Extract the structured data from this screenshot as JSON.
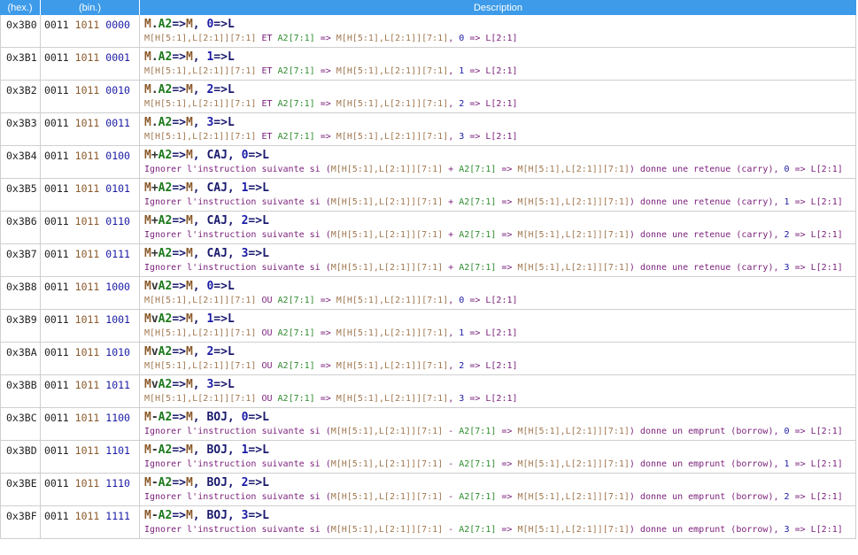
{
  "header": {
    "hex": "(hex.)",
    "bin": "(bin.)",
    "desc": "Description"
  },
  "rows": [
    {
      "hex": "0x3B0",
      "b1": "0011",
      "b2": "1011",
      "b3": "0000",
      "l1": [
        "M",
        ".",
        "A2",
        "=>",
        "M",
        ", ",
        "0",
        "=>",
        "L"
      ],
      "l2": "M[H[5:1],L[2:1]][7:1] ET A2[7:1] => M[H[5:1],L[2:1]][7:1], 0 => L[2:1]"
    },
    {
      "hex": "0x3B1",
      "b1": "0011",
      "b2": "1011",
      "b3": "0001",
      "l1": [
        "M",
        ".",
        "A2",
        "=>",
        "M",
        ", ",
        "1",
        "=>",
        "L"
      ],
      "l2": "M[H[5:1],L[2:1]][7:1] ET A2[7:1] => M[H[5:1],L[2:1]][7:1], 1 => L[2:1]"
    },
    {
      "hex": "0x3B2",
      "b1": "0011",
      "b2": "1011",
      "b3": "0010",
      "l1": [
        "M",
        ".",
        "A2",
        "=>",
        "M",
        ", ",
        "2",
        "=>",
        "L"
      ],
      "l2": "M[H[5:1],L[2:1]][7:1] ET A2[7:1] => M[H[5:1],L[2:1]][7:1], 2 => L[2:1]"
    },
    {
      "hex": "0x3B3",
      "b1": "0011",
      "b2": "1011",
      "b3": "0011",
      "l1": [
        "M",
        ".",
        "A2",
        "=>",
        "M",
        ", ",
        "3",
        "=>",
        "L"
      ],
      "l2": "M[H[5:1],L[2:1]][7:1] ET A2[7:1] => M[H[5:1],L[2:1]][7:1], 3 => L[2:1]"
    },
    {
      "hex": "0x3B4",
      "b1": "0011",
      "b2": "1011",
      "b3": "0100",
      "l1": [
        "M",
        "+",
        "A2",
        "=>",
        "M",
        ", CAJ, ",
        "0",
        "=>",
        "L"
      ],
      "l2": "Ignorer l'instruction suivante si (M[H[5:1],L[2:1]][7:1] + A2[7:1] => M[H[5:1],L[2:1]][7:1]) donne une retenue (carry), 0 => L[2:1]"
    },
    {
      "hex": "0x3B5",
      "b1": "0011",
      "b2": "1011",
      "b3": "0101",
      "l1": [
        "M",
        "+",
        "A2",
        "=>",
        "M",
        ", CAJ, ",
        "1",
        "=>",
        "L"
      ],
      "l2": "Ignorer l'instruction suivante si (M[H[5:1],L[2:1]][7:1] + A2[7:1] => M[H[5:1],L[2:1]][7:1]) donne une retenue (carry), 1 => L[2:1]"
    },
    {
      "hex": "0x3B6",
      "b1": "0011",
      "b2": "1011",
      "b3": "0110",
      "l1": [
        "M",
        "+",
        "A2",
        "=>",
        "M",
        ", CAJ, ",
        "2",
        "=>",
        "L"
      ],
      "l2": "Ignorer l'instruction suivante si (M[H[5:1],L[2:1]][7:1] + A2[7:1] => M[H[5:1],L[2:1]][7:1]) donne une retenue (carry), 2 => L[2:1]"
    },
    {
      "hex": "0x3B7",
      "b1": "0011",
      "b2": "1011",
      "b3": "0111",
      "l1": [
        "M",
        "+",
        "A2",
        "=>",
        "M",
        ", CAJ, ",
        "3",
        "=>",
        "L"
      ],
      "l2": "Ignorer l'instruction suivante si (M[H[5:1],L[2:1]][7:1] + A2[7:1] => M[H[5:1],L[2:1]][7:1]) donne une retenue (carry), 3 => L[2:1]"
    },
    {
      "hex": "0x3B8",
      "b1": "0011",
      "b2": "1011",
      "b3": "1000",
      "l1": [
        "M",
        "v",
        "A2",
        "=>",
        "M",
        ", ",
        "0",
        "=>",
        "L"
      ],
      "l2": "M[H[5:1],L[2:1]][7:1] OU A2[7:1] => M[H[5:1],L[2:1]][7:1], 0 => L[2:1]"
    },
    {
      "hex": "0x3B9",
      "b1": "0011",
      "b2": "1011",
      "b3": "1001",
      "l1": [
        "M",
        "v",
        "A2",
        "=>",
        "M",
        ", ",
        "1",
        "=>",
        "L"
      ],
      "l2": "M[H[5:1],L[2:1]][7:1] OU A2[7:1] => M[H[5:1],L[2:1]][7:1], 1 => L[2:1]"
    },
    {
      "hex": "0x3BA",
      "b1": "0011",
      "b2": "1011",
      "b3": "1010",
      "l1": [
        "M",
        "v",
        "A2",
        "=>",
        "M",
        ", ",
        "2",
        "=>",
        "L"
      ],
      "l2": "M[H[5:1],L[2:1]][7:1] OU A2[7:1] => M[H[5:1],L[2:1]][7:1], 2 => L[2:1]"
    },
    {
      "hex": "0x3BB",
      "b1": "0011",
      "b2": "1011",
      "b3": "1011",
      "l1": [
        "M",
        "v",
        "A2",
        "=>",
        "M",
        ", ",
        "3",
        "=>",
        "L"
      ],
      "l2": "M[H[5:1],L[2:1]][7:1] OU A2[7:1] => M[H[5:1],L[2:1]][7:1], 3 => L[2:1]"
    },
    {
      "hex": "0x3BC",
      "b1": "0011",
      "b2": "1011",
      "b3": "1100",
      "l1": [
        "M",
        "-",
        "A2",
        "=>",
        "M",
        ", BOJ, ",
        "0",
        "=>",
        "L"
      ],
      "l2": "Ignorer l'instruction suivante si (M[H[5:1],L[2:1]][7:1] - A2[7:1] => M[H[5:1],L[2:1]][7:1]) donne un emprunt (borrow), 0 => L[2:1]"
    },
    {
      "hex": "0x3BD",
      "b1": "0011",
      "b2": "1011",
      "b3": "1101",
      "l1": [
        "M",
        "-",
        "A2",
        "=>",
        "M",
        ", BOJ, ",
        "1",
        "=>",
        "L"
      ],
      "l2": "Ignorer l'instruction suivante si (M[H[5:1],L[2:1]][7:1] - A2[7:1] => M[H[5:1],L[2:1]][7:1]) donne un emprunt (borrow), 1 => L[2:1]"
    },
    {
      "hex": "0x3BE",
      "b1": "0011",
      "b2": "1011",
      "b3": "1110",
      "l1": [
        "M",
        "-",
        "A2",
        "=>",
        "M",
        ", BOJ, ",
        "2",
        "=>",
        "L"
      ],
      "l2": "Ignorer l'instruction suivante si (M[H[5:1],L[2:1]][7:1] - A2[7:1] => M[H[5:1],L[2:1]][7:1]) donne un emprunt (borrow), 2 => L[2:1]"
    },
    {
      "hex": "0x3BF",
      "b1": "0011",
      "b2": "1011",
      "b3": "1111",
      "l1": [
        "M",
        "-",
        "A2",
        "=>",
        "M",
        ", BOJ, ",
        "3",
        "=>",
        "L"
      ],
      "l2": "Ignorer l'instruction suivante si (M[H[5:1],L[2:1]][7:1] - A2[7:1] => M[H[5:1],L[2:1]][7:1]) donne un emprunt (borrow), 3 => L[2:1]"
    }
  ]
}
